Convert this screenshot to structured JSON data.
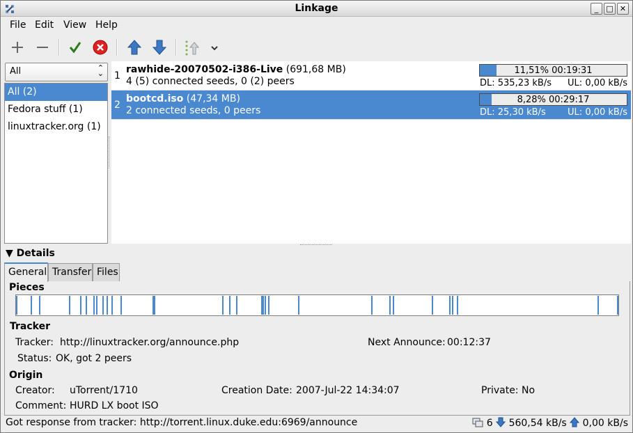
{
  "window": {
    "title": "Linkage"
  },
  "menubar": {
    "items": [
      "File",
      "Edit",
      "View",
      "Help"
    ]
  },
  "sidebar": {
    "filter_selected": "All",
    "items": [
      "All (2)",
      "Fedora stuff (1)",
      "linuxtracker.org (1)"
    ]
  },
  "torrents": [
    {
      "index": "1",
      "name": "rawhide-20070502-i386-Live",
      "size": "(691,68 MB)",
      "peers": "4 (5) connected seeds, 0 (2) peers",
      "progress_text": "11,51% 00:19:31",
      "progress": 0.1151,
      "dl": "DL: 535,23 kB/s",
      "ul": "UL: 0,00 kB/s"
    },
    {
      "index": "2",
      "name": "bootcd.iso",
      "size": "(47,34 MB)",
      "peers": "2 connected seeds, 0 peers",
      "progress_text": "8,28% 00:29:17",
      "progress": 0.0828,
      "dl": "DL: 25,30 kB/s",
      "ul": "UL: 0,00 kB/s"
    }
  ],
  "details": {
    "header": "Details",
    "tabs": [
      "General",
      "Transfer",
      "Files"
    ],
    "pieces_title": "Pieces",
    "tracker_title": "Tracker",
    "tracker_label": "Tracker:",
    "tracker_value": "http://linuxtracker.org/announce.php",
    "next_announce_label": "Next Announce:",
    "next_announce_value": "00:12:37",
    "status_label": "Status:",
    "status_value": "OK, got 2 peers",
    "origin_title": "Origin",
    "creator_label": "Creator:",
    "creator_value": "uTorrent/1710",
    "creation_date_label": "Creation Date:",
    "creation_date_value": "2007-Jul-22 14:34:07",
    "private_label": "Private:",
    "private_value": "No",
    "comment_label": "Comment:",
    "comment_value": "HURD LX boot ISO"
  },
  "statusbar": {
    "message": "Got response from tracker: http://torrent.linux.duke.edu:6969/announce",
    "peers": "6",
    "down": "560,54 kB/s",
    "up": "0,00 kB/s"
  },
  "colors": {
    "accent": "#4a88cf",
    "remove": "#d22",
    "ok": "#2d7a1e"
  }
}
